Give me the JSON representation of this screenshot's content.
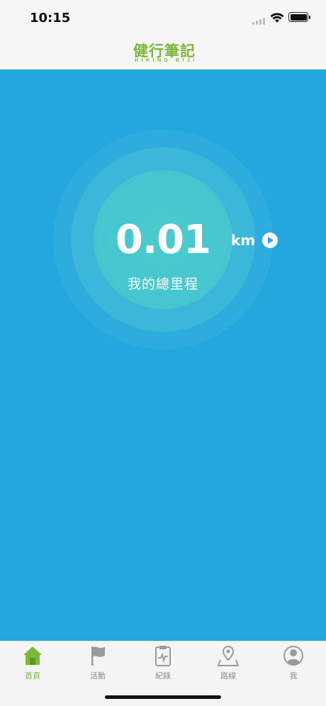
{
  "status_bar": {
    "time": "10:15"
  },
  "nav": {
    "logo_title": "健行筆記",
    "logo_subtitle": "HIKING BIJI",
    "logo_color": "#7ab83a"
  },
  "main": {
    "background": "#24a6df",
    "distance_value": "0.01",
    "distance_unit": "km",
    "distance_label": "我的總里程"
  },
  "tabs": [
    {
      "label": "首頁",
      "icon": "home-icon",
      "active": true
    },
    {
      "label": "活動",
      "icon": "flag-icon",
      "active": false
    },
    {
      "label": "紀錄",
      "icon": "record-clipboard-icon",
      "active": false
    },
    {
      "label": "路線",
      "icon": "map-pin-icon",
      "active": false
    },
    {
      "label": "我",
      "icon": "profile-icon",
      "active": false
    }
  ],
  "colors": {
    "active_tab": "#7ab83a",
    "inactive_tab": "#8e8e8e"
  }
}
